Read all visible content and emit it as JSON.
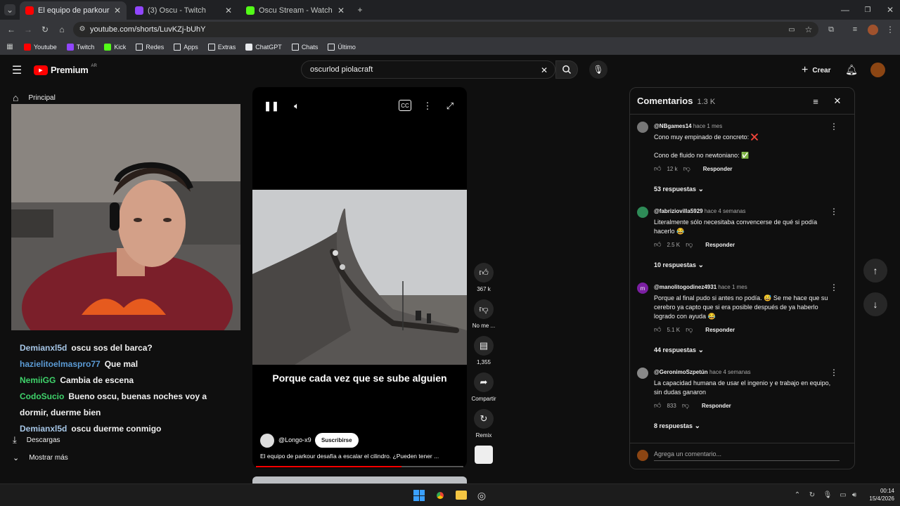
{
  "browser": {
    "tabs": [
      {
        "title": "El equipo de parkour desafí",
        "color": "#ff0000",
        "active": true
      },
      {
        "title": "(3) Oscu - Twitch",
        "color": "#9146ff",
        "active": false
      },
      {
        "title": "Oscu Stream - Watch Live on K",
        "color": "#53fc18",
        "active": false
      }
    ],
    "new_tab": "+",
    "url": "youtube.com/shorts/LuvKZj-bUhY",
    "bookmarks": [
      {
        "label": "Youtube",
        "icon": "youtube-icon",
        "color": "#ff0000"
      },
      {
        "label": "Twitch",
        "icon": "twitch-icon",
        "color": "#9146ff"
      },
      {
        "label": "Kick",
        "icon": "kick-icon",
        "color": "#53fc18"
      },
      {
        "label": "Redes",
        "icon": "folder-icon",
        "color": "#e8eaed"
      },
      {
        "label": "Apps",
        "icon": "folder-icon",
        "color": "#e8eaed"
      },
      {
        "label": "Extras",
        "icon": "folder-icon",
        "color": "#e8eaed"
      },
      {
        "label": "ChatGPT",
        "icon": "chatgpt-icon",
        "color": "#e8eaed"
      },
      {
        "label": "Chats",
        "icon": "folder-icon",
        "color": "#e8eaed"
      },
      {
        "label": "Último",
        "icon": "folder-icon",
        "color": "#e8eaed"
      }
    ]
  },
  "youtube": {
    "logo": "Premium",
    "country": "AR",
    "search_value": "oscurlod piolacraft",
    "create_label": "Crear",
    "sidebar": {
      "home": "Principal",
      "downloads": "Descargas",
      "more": "Mostrar más"
    },
    "short": {
      "caption": "Porque cada vez que se sube alguien",
      "channel": "@Longo-x9",
      "subscribe": "Suscribirse",
      "title": "El equipo de parkour desafía a escalar el cilindro. ¿Pueden tener ...",
      "progress": 0.7,
      "likes": "367 k",
      "dislike": "No me ...",
      "comments": "1,355",
      "share": "Compartir",
      "remix": "Remix"
    },
    "comments_panel": {
      "title": "Comentarios",
      "count": "1.3 K",
      "items": [
        {
          "user": "@NBgames14",
          "time": "hace 1 mes",
          "lines": [
            "Cono muy empinado de concreto: ❌",
            "",
            "Cono de fluido no newtoniano: ✅"
          ],
          "likes": "12 k",
          "reply": "Responder",
          "replies": "53 respuestas",
          "avatar_color": "#777"
        },
        {
          "user": "@fabriziovilla5929",
          "time": "hace 4 semanas",
          "lines": [
            "Literalmente sólo necesitaba convencerse de qué si podía",
            "hacerlo 😂"
          ],
          "likes": "2.5 K",
          "reply": "Responder",
          "replies": "10 respuestas",
          "avatar_color": "#2e8b57"
        },
        {
          "user": "@manolitogodinez4931",
          "time": "hace 1 mes",
          "lines": [
            "Porque al final pudo si antes no podía. 😅 Se me hace que su",
            "cerebro ya capto que si era posible después de ya haberlo",
            "logrado con ayuda 😂"
          ],
          "likes": "5.1 K",
          "reply": "Responder",
          "replies": "44 respuestas",
          "avatar_color": "#7b1fa2",
          "avatar_letter": "m"
        },
        {
          "user": "@GeronimoSzpetún",
          "time": "hace 4 semanas",
          "lines": [
            "La capacidad humana de usar el ingenio y e trabajo en equipo,",
            "sin dudas ganaron"
          ],
          "likes": "833",
          "reply": "Responder",
          "replies": "8 respuestas",
          "avatar_color": "#888"
        }
      ],
      "add_placeholder": "Agrega un comentario..."
    }
  },
  "chat": [
    {
      "user": "Demianxl5d",
      "text": "oscu sos del barca?",
      "color": "#a7c7e7"
    },
    {
      "user": "hazielitoelmaspro77",
      "text": "Que mal",
      "color": "#5b9bd5"
    },
    {
      "user": "NemiiGG",
      "text": "Cambia de escena",
      "color": "#3fd36b"
    },
    {
      "user": "CodoSucio",
      "text": "Bueno oscu, buenas noches voy a dormir, duerme bien",
      "color": "#3fd36b"
    },
    {
      "user": "Demianxl5d",
      "text": "oscu duerme conmigo",
      "color": "#a7c7e7"
    }
  ],
  "taskbar": {
    "time": "00:14",
    "date": "15/4/2026"
  }
}
